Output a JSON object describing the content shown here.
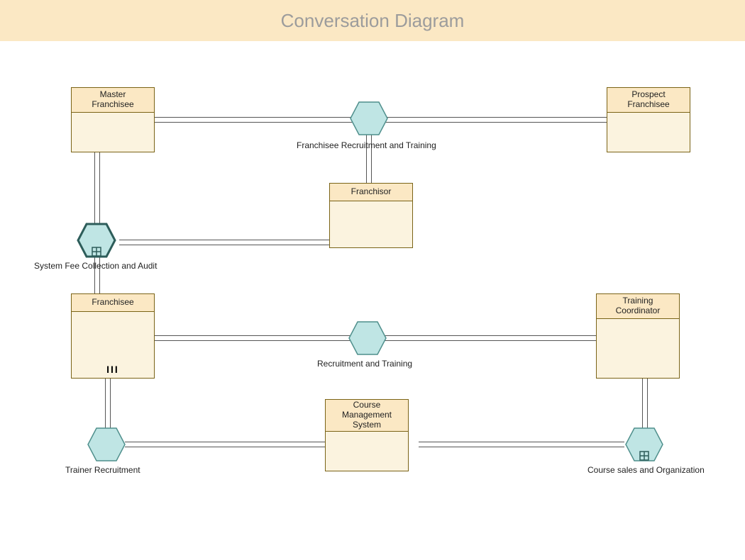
{
  "title": "Conversation Diagram",
  "pools": {
    "master_franchisee": "Master\nFranchisee",
    "prospect_franchisee": "Prospect\nFranchisee",
    "franchisor": "Franchisor",
    "franchisee": "Franchisee",
    "training_coordinator": "Training\nCoordinator",
    "course_mgmt": "Course\nManagement\nSystem"
  },
  "conversations": {
    "franchisee_recruitment_training": "Franchisee Recruitment and Training",
    "system_fee_collection": "System Fee Collection and Audit",
    "recruitment_training": "Recruitment and Training",
    "trainer_recruitment": "Trainer Recruitment",
    "course_sales_org": "Course sales and Organization"
  },
  "multi_instance_marker": "III"
}
